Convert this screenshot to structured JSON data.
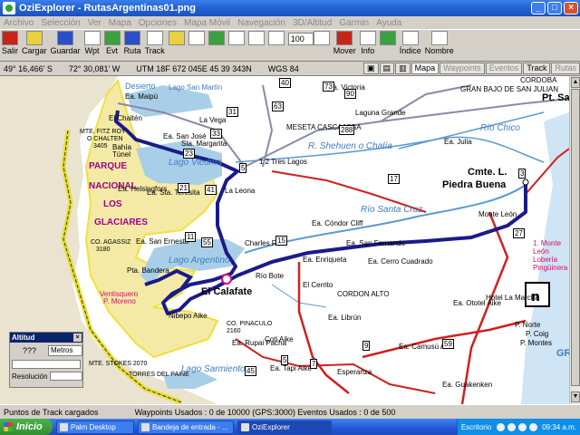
{
  "window": {
    "title": "OziExplorer - RutasArgentinas01.png"
  },
  "menu": [
    "Archivo",
    "Selección",
    "Ver",
    "Mapa",
    "Opciones",
    "Mapa Móvil",
    "Navegación",
    "3D/Altitud",
    "Garmin",
    "Ayuda"
  ],
  "toolbar": {
    "tools": [
      {
        "label": "Salir",
        "icon": "exit-icon"
      },
      {
        "label": "Cargar",
        "icon": "load-icon"
      },
      {
        "label": "Guardar",
        "icon": "save-icon"
      },
      {
        "label": "Wpt",
        "icon": "waypoint-icon"
      },
      {
        "label": "Evt",
        "icon": "event-icon"
      },
      {
        "label": "Ruta",
        "icon": "route-icon"
      },
      {
        "label": "Track",
        "icon": "track-icon"
      },
      {
        "label": "Mover",
        "icon": "move-icon"
      },
      {
        "label": "Info",
        "icon": "info-icon"
      },
      {
        "label": "Índice",
        "icon": "index-icon"
      },
      {
        "label": "Nombre",
        "icon": "name-icon"
      }
    ],
    "zoom_value": "100"
  },
  "coords": {
    "lat": "49° 16,466' S",
    "lon": "72° 30,081' W",
    "utm": "UTM  18F  672 045E  45 39 343N",
    "datum": "WGS 84"
  },
  "tabs": [
    {
      "label": "Mapa",
      "state": "active"
    },
    {
      "label": "Waypoints",
      "state": "dim"
    },
    {
      "label": "Eventos",
      "state": "dim"
    },
    {
      "label": "Track",
      "state": "normal"
    },
    {
      "label": "Rutas",
      "state": "dim"
    }
  ],
  "map": {
    "labels": {
      "desierto": "Desierto",
      "maipu": "Ea. Maipú",
      "chalten": "El Chaltén",
      "fitzroy": "MTE. FITZ ROY",
      "fitzroy2": "O CHALTEN",
      "fitzroy3": "3405",
      "bahia": "Bahía",
      "tunel": "Túnel",
      "sanjose": "Ea. San José",
      "margarita": "Sta. Margarita",
      "lavega": "La Vega",
      "sanmartin": "Lago San Martín",
      "parque": "PARQUE",
      "nacional": "NACIONAL",
      "los": "LOS",
      "glaciares": "GLACIARES",
      "viedma": "Lago Viedma",
      "helsingfors": "Ea. Helsingfors",
      "teresita": "Ea. Sta. Teresita",
      "laleona": "La Leona",
      "agassiz": "CO. AGASSIZ",
      "agassiz2": "3180",
      "sanernesto": "Ea. San Ernesto",
      "argentino": "Lago Argentino",
      "bandera": "Pta. Bandera",
      "ventisquero": "Ventisquero",
      "moreno": "P. Moreno",
      "elcalafate": "El Calafate",
      "riobote": "Río Bote",
      "charles": "Charles Fuhr",
      "nibepo": "Nibepo Aike",
      "victoria": "Ea. Victoria",
      "meseta": "MESETA CASCAJOSA",
      "laguna": "Laguna Grande",
      "trestagos": "1  2  Tres Lagos",
      "shehuen": "R. Shehuen o Chalía",
      "julia": "Ea. Julia",
      "riochico": "Río Chico",
      "grandebajo": "GRAN BAJO DE SAN JULIAN",
      "cordoba": "CORDOBA",
      "ptsta": "Pt. Sa",
      "cmte": "Cmte. L.",
      "piedrabuena": "Piedra Buena",
      "monteleon": "Monte León",
      "santacruz": "Río Santa Cruz",
      "condor": "Ea. Cóndor Cliff",
      "sanfernando": "Ea. San Fernando",
      "enriqueta": "Ea. Enriqueta",
      "cerro": "Ea. Cerro Cuadrado",
      "elcerrito": "El Cerrito",
      "cordon": "CORDON ALTO",
      "libron": "Ea. Librún",
      "cotiaike": "Coti Aike",
      "camusu": "Ea. Camusú Aike",
      "otoltel": "Ea. Ototel Aike",
      "hotel": "Hotel La Marcha",
      "pnorte": "P. Norte",
      "pcoig": "P. Coig",
      "pmontes": "P. Montes",
      "loberia": "1. Monte León Lobería Pingüinera",
      "pinaculo": "CO. PINACULO",
      "pinaculo2": "2160",
      "rupai": "Ea. Rupai Pacha",
      "esperanza": "Esperanza",
      "tapi": "Ea. Tapi Aike",
      "guakenken": "Ea. Guakenken",
      "stokes": "MTE. STOKES 2070",
      "torres": "TORRES DEL PAINE",
      "sarmiento": "Lago Sarmiento",
      "gr": "GR"
    },
    "road_numbers": [
      "40",
      "73",
      "90",
      "63",
      "31",
      "288",
      "33",
      "23",
      "5",
      "21",
      "41",
      "11",
      "15",
      "55",
      "17",
      "3",
      "27",
      "59",
      "7",
      "5",
      "9",
      "45"
    ]
  },
  "altitud": {
    "title": "Altitud",
    "value": "???",
    "units": "Metros",
    "resolution_label": "Resolución"
  },
  "status": {
    "left": "Puntos de Track cargados",
    "middle": "Waypoints Usados : 0 de 10000  (GPS:3000)  Eventos Usados : 0 de 500"
  },
  "taskbar": {
    "start": "Inicio",
    "tasks": [
      {
        "label": "Palm Desktop",
        "active": false
      },
      {
        "label": "Bandeja de entrada - ...",
        "active": false
      },
      {
        "label": "OziExplorer",
        "active": true
      }
    ],
    "desktop": "Escritorio",
    "clock": "09:34 a.m."
  }
}
